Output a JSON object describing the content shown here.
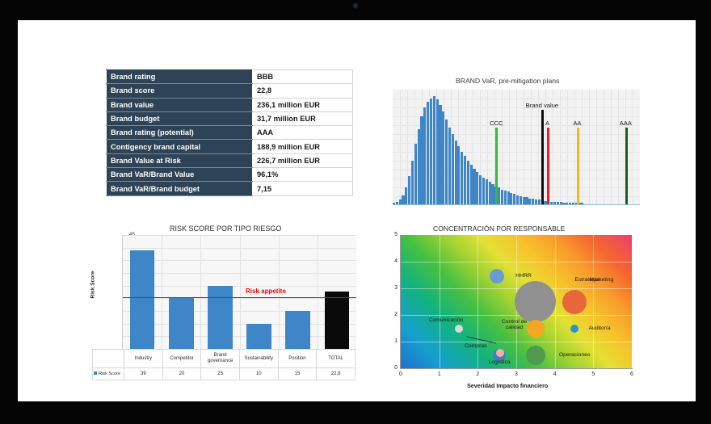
{
  "kpi_table": {
    "rows": [
      {
        "key": "Brand rating",
        "value": "BBB"
      },
      {
        "key": "Brand score",
        "value": "22,8"
      },
      {
        "key": "Brand value",
        "value": "236,1 million EUR"
      },
      {
        "key": "Brand budget",
        "value": "31,7 million EUR"
      },
      {
        "key": "Brand rating (potential)",
        "value": "AAA"
      },
      {
        "key": "Contigency brand capital",
        "value": "188,9 million EUR"
      },
      {
        "key": "Brand Value at Risk",
        "value": "226,7 million EUR"
      },
      {
        "key": "Brand VaR/Brand Value",
        "value": "96,1%"
      },
      {
        "key": "Brand VaR/Brand budget",
        "value": "7,15"
      }
    ]
  },
  "chart_data": [
    {
      "id": "histogram",
      "type": "bar",
      "title": "BRAND VaR, pre-mitigation plans",
      "xlabel": "",
      "ylabel": "",
      "grid": true,
      "series_color": "#3e86c8",
      "values": [
        2,
        3,
        5,
        9,
        16,
        26,
        40,
        55,
        68,
        80,
        88,
        93,
        96,
        98,
        95,
        90,
        84,
        77,
        70,
        64,
        58,
        53,
        48,
        44,
        40,
        36,
        33,
        30,
        27,
        25,
        23,
        21,
        19,
        17,
        16,
        14,
        13,
        12,
        11,
        10,
        9,
        8,
        7,
        7,
        6,
        6,
        5,
        5,
        4,
        4,
        4,
        3,
        3,
        3,
        3,
        2,
        2,
        2,
        2,
        2,
        2,
        2,
        1,
        1,
        1,
        1,
        1,
        1,
        1,
        1,
        1,
        1,
        1,
        1,
        1,
        1,
        1,
        1,
        1,
        1
      ],
      "markers": [
        {
          "label": "CCC",
          "color": "#3eb53e",
          "x_pct": 41.5
        },
        {
          "label": "Brand value",
          "color": "#0d0d0d",
          "x_pct": 60.0,
          "tall": true
        },
        {
          "label": "A",
          "color": "#ed1c24",
          "x_pct": 62.5
        },
        {
          "label": "AA",
          "color": "#f7b320",
          "x_pct": 74.5
        },
        {
          "label": "AAA",
          "color": "#1d5c22",
          "x_pct": 94.0
        }
      ]
    },
    {
      "id": "risk-score",
      "type": "bar",
      "title": "RISK SCORE POR TIPO RIESGO",
      "xlabel": "",
      "ylabel": "Risk Score",
      "ylim": [
        0,
        45
      ],
      "yticks": [
        "45",
        "40",
        "35",
        "30",
        "25",
        "20",
        "15",
        "10",
        "5",
        "0"
      ],
      "legend": "Risk Score",
      "legend_color": "#3e86c8",
      "row_header": "Risk Score",
      "categories": [
        "Industry",
        "Competitor",
        "Brand governance",
        "Sustainability",
        "Position",
        "TOTAL"
      ],
      "value_labels": [
        "39",
        "20",
        "25",
        "10",
        "15",
        "22,8"
      ],
      "values": [
        39,
        20,
        25,
        10,
        15,
        22.8
      ],
      "colors": [
        "#3e86c8",
        "#3e86c8",
        "#3e86c8",
        "#3e86c8",
        "#3e86c8",
        "#0a0a0a"
      ],
      "threshold": {
        "label": "Risk appetite",
        "value": 20,
        "color": "#ff0000"
      }
    },
    {
      "id": "concentracion",
      "type": "scatter",
      "title": "CONCENTRACIÓN POR RESPONSABLE",
      "xlabel": "Severidad Impacto financiero",
      "ylabel": "",
      "xlim": [
        0,
        6
      ],
      "ylim": [
        0,
        5
      ],
      "xticks": [
        "0",
        "1",
        "2",
        "3",
        "4",
        "5",
        "6"
      ],
      "yticks": [
        "0",
        "1",
        "2",
        "3",
        "4",
        "5"
      ],
      "grid": true,
      "points": [
        {
          "label": "HHRR",
          "x": 2.5,
          "y": 3.45,
          "r": 9,
          "color": "#6b9bd2",
          "label_dx": 14,
          "label_dy": -4
        },
        {
          "label": "Estrategia",
          "x": 3.5,
          "y": 2.5,
          "r": 25.5,
          "color": "#909090",
          "label_dx": 23,
          "label_dy": -31
        },
        {
          "label": "Marketing",
          "x": 4.5,
          "y": 2.5,
          "r": 15,
          "color": "#e8663c",
          "label_dx": 4,
          "label_dy": -31
        },
        {
          "label": "Control de calidad",
          "x": 3.5,
          "y": 1.5,
          "r": 11,
          "color": "#f5a623",
          "label_dx": -53,
          "label_dy": -12
        },
        {
          "label": "Comunicación",
          "x": 1.5,
          "y": 1.5,
          "r": 5,
          "color": "#d9d9d9",
          "label_dx": -42,
          "label_dy": -14
        },
        {
          "label": "Auditoría",
          "x": 4.5,
          "y": 1.5,
          "r": 5,
          "color": "#2e8fd4",
          "label_dx": 13,
          "label_dy": -4
        },
        {
          "label": "Operaciones",
          "x": 3.5,
          "y": 0.5,
          "r": 12,
          "color": "#4e9a4e",
          "label_dx": 17,
          "label_dy": -4
        },
        {
          "label": "Logística",
          "x": 2.55,
          "y": 0.5,
          "r": 8,
          "color": "#3f7fc1",
          "label_dx": -21,
          "label_dy": 5
        },
        {
          "label": "Compras",
          "x": 2.58,
          "y": 0.58,
          "r": 5,
          "color": "#f3b0a0",
          "label_dx": -49,
          "label_dy": -12
        }
      ]
    }
  ]
}
